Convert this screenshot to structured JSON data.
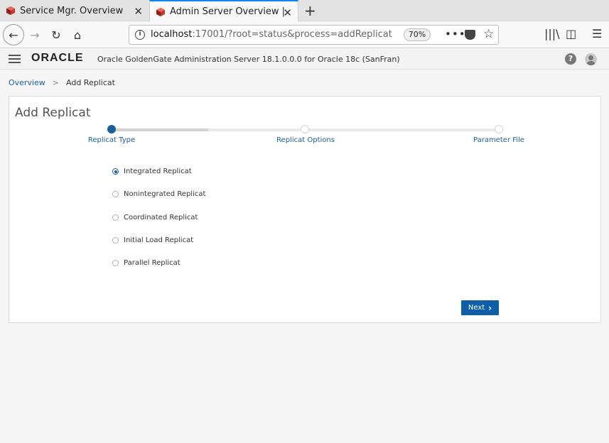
{
  "browser": {
    "tabs": [
      {
        "title": "Service Mgr. Overview",
        "active": false
      },
      {
        "title": "Admin Server Overview |",
        "active": true
      }
    ],
    "url_host": "localhost",
    "url_rest": ":17001/?root=status&process=addReplicat",
    "zoom": "70%"
  },
  "app": {
    "logo": "ORACLE",
    "title": "Oracle GoldenGate Administration Server 18.1.0.0.0 for Oracle 18c (SanFran)",
    "help_glyph": "?"
  },
  "breadcrumb": {
    "home": "Overview",
    "separator": ">",
    "current": "Add Replicat"
  },
  "panel": {
    "title": "Add Replicat",
    "steps": [
      {
        "label": "Replicat Type",
        "active": true
      },
      {
        "label": "Replicat Options",
        "active": false
      },
      {
        "label": "Parameter File",
        "active": false
      }
    ],
    "options": [
      {
        "label": "Integrated Replicat",
        "checked": true
      },
      {
        "label": "Nonintegrated Replicat",
        "checked": false
      },
      {
        "label": "Coordinated Replicat",
        "checked": false
      },
      {
        "label": "Initial Load Replicat",
        "checked": false
      },
      {
        "label": "Parallel Replicat",
        "checked": false
      }
    ],
    "next_label": "Next"
  },
  "colors": {
    "accent": "#1a5f9e",
    "button": "#0e5fa8"
  }
}
